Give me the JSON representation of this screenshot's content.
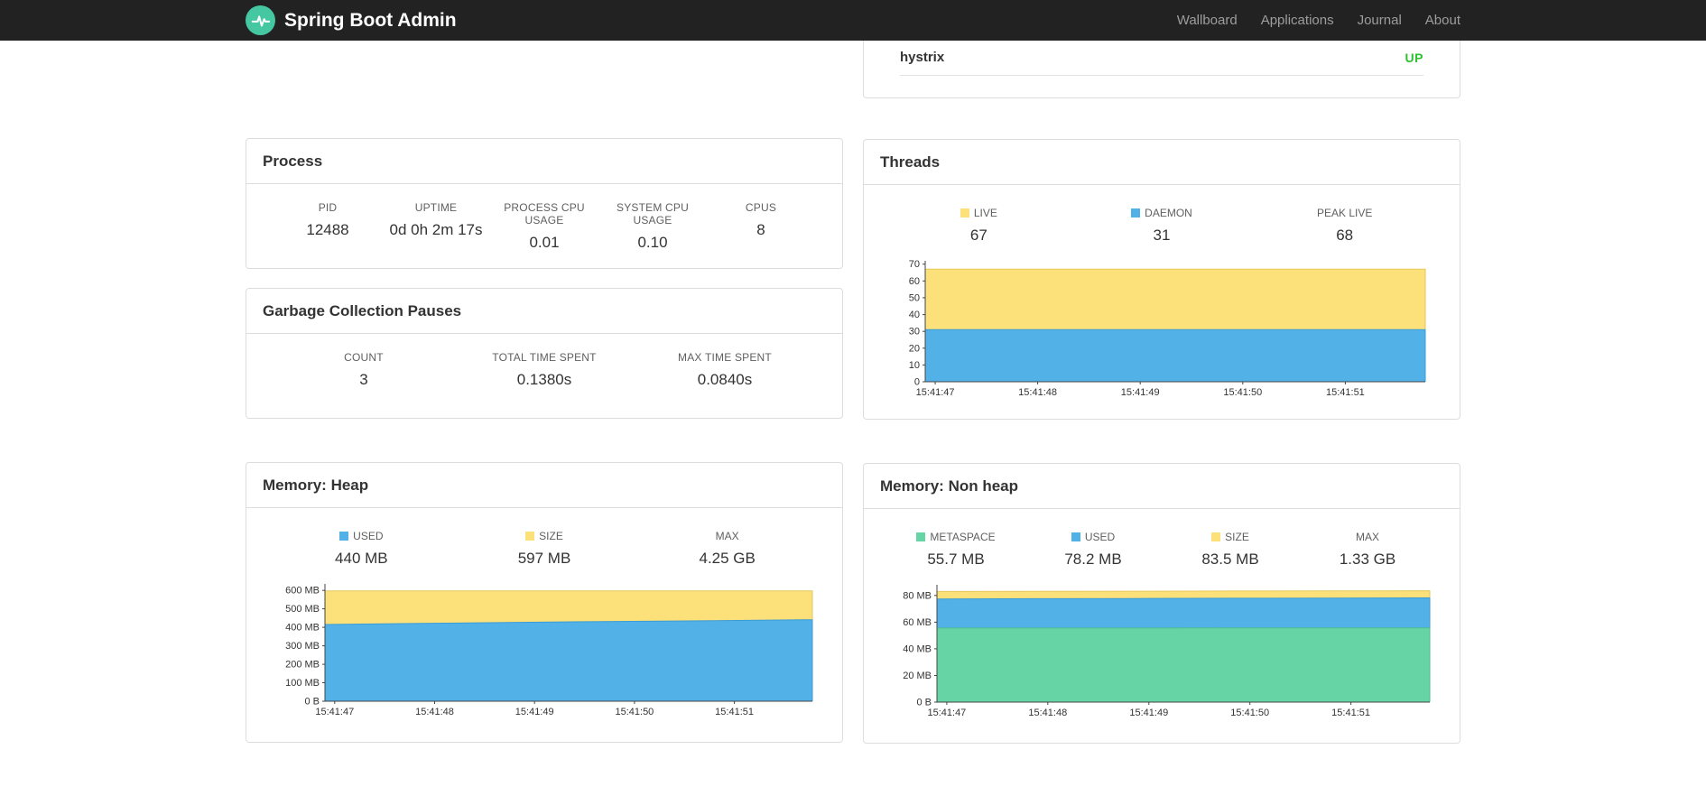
{
  "colors": {
    "brand_teal": "#45C8A2",
    "navbar_bg": "#222222"
  },
  "navbar": {
    "brand": "Spring Boot Admin",
    "links": [
      {
        "label": "Wallboard"
      },
      {
        "label": "Applications"
      },
      {
        "label": "Journal"
      },
      {
        "label": "About"
      }
    ]
  },
  "applications_panel": {
    "app_name": "hystrix",
    "status": "UP",
    "status_color": "#2EC12E"
  },
  "process": {
    "title": "Process",
    "metrics": [
      {
        "label": "PID",
        "value": "12488"
      },
      {
        "label": "UPTIME",
        "value": "0d 0h 2m 17s"
      },
      {
        "label": "PROCESS CPU USAGE",
        "value": "0.01"
      },
      {
        "label": "SYSTEM CPU USAGE",
        "value": "0.10"
      },
      {
        "label": "CPUS",
        "value": "8"
      }
    ]
  },
  "gc": {
    "title": "Garbage Collection Pauses",
    "metrics": [
      {
        "label": "COUNT",
        "value": "3"
      },
      {
        "label": "TOTAL TIME SPENT",
        "value": "0.1380s"
      },
      {
        "label": "MAX TIME SPENT",
        "value": "0.0840s"
      }
    ]
  },
  "threads": {
    "title": "Threads",
    "legend": [
      {
        "label": "LIVE",
        "value": "67",
        "color": "#FCE17B"
      },
      {
        "label": "DAEMON",
        "value": "31",
        "color": "#52B2E8"
      },
      {
        "label": "PEAK LIVE",
        "value": "68"
      }
    ]
  },
  "memory_heap": {
    "title": "Memory: Heap",
    "legend": [
      {
        "label": "USED",
        "value": "440 MB",
        "color": "#52B2E8"
      },
      {
        "label": "SIZE",
        "value": "597 MB",
        "color": "#FCE17B"
      },
      {
        "label": "MAX",
        "value": "4.25 GB"
      }
    ]
  },
  "memory_nonheap": {
    "title": "Memory: Non heap",
    "legend": [
      {
        "label": "METASPACE",
        "value": "55.7 MB",
        "color": "#67D4A6"
      },
      {
        "label": "USED",
        "value": "78.2 MB",
        "color": "#52B2E8"
      },
      {
        "label": "SIZE",
        "value": "83.5 MB",
        "color": "#FCE17B"
      },
      {
        "label": "MAX",
        "value": "1.33 GB"
      }
    ]
  },
  "chart_data": [
    {
      "id": "threads-chart",
      "type": "area",
      "title": "Threads",
      "xlabel": "",
      "ylabel": "",
      "legend_position": "top",
      "grid": false,
      "x_ticks": [
        "15:41:47",
        "15:41:48",
        "15:41:49",
        "15:41:50",
        "15:41:51"
      ],
      "y_ticks": [
        {
          "label": "0",
          "value": 0
        },
        {
          "label": "10",
          "value": 10
        },
        {
          "label": "20",
          "value": 20
        },
        {
          "label": "30",
          "value": 30
        },
        {
          "label": "40",
          "value": 40
        },
        {
          "label": "50",
          "value": 50
        },
        {
          "label": "60",
          "value": 60
        },
        {
          "label": "70",
          "value": 70
        }
      ],
      "ylim": [
        0,
        72
      ],
      "series": [
        {
          "name": "LIVE",
          "color": "#FCE17B",
          "stroke": "#E5C75B",
          "values": [
            67,
            67,
            67,
            67,
            67,
            67
          ]
        },
        {
          "name": "DAEMON",
          "color": "#52B2E8",
          "stroke": "#3B9BD6",
          "values": [
            31,
            31,
            31,
            31,
            31,
            31
          ]
        }
      ]
    },
    {
      "id": "memory-heap-chart",
      "type": "area",
      "title": "Memory: Heap",
      "xlabel": "",
      "ylabel": "",
      "legend_position": "top",
      "grid": false,
      "x_ticks": [
        "15:41:47",
        "15:41:48",
        "15:41:49",
        "15:41:50",
        "15:41:51"
      ],
      "y_ticks": [
        {
          "label": "0 B",
          "value": 0
        },
        {
          "label": "100 MB",
          "value": 100
        },
        {
          "label": "200 MB",
          "value": 200
        },
        {
          "label": "300 MB",
          "value": 300
        },
        {
          "label": "400 MB",
          "value": 400
        },
        {
          "label": "500 MB",
          "value": 500
        },
        {
          "label": "600 MB",
          "value": 600
        }
      ],
      "ylim": [
        0,
        635
      ],
      "series": [
        {
          "name": "SIZE",
          "color": "#FCE17B",
          "stroke": "#E5C75B",
          "values": [
            597,
            597,
            597,
            597,
            597,
            597
          ]
        },
        {
          "name": "USED",
          "color": "#52B2E8",
          "stroke": "#3B9BD6",
          "values": [
            415,
            421,
            427,
            432,
            436,
            441
          ]
        }
      ]
    },
    {
      "id": "memory-nonheap-chart",
      "type": "area",
      "title": "Memory: Non heap",
      "xlabel": "",
      "ylabel": "",
      "legend_position": "top",
      "grid": false,
      "x_ticks": [
        "15:41:47",
        "15:41:48",
        "15:41:49",
        "15:41:50",
        "15:41:51"
      ],
      "y_ticks": [
        {
          "label": "0 B",
          "value": 0
        },
        {
          "label": "20 MB",
          "value": 20
        },
        {
          "label": "40 MB",
          "value": 40
        },
        {
          "label": "60 MB",
          "value": 60
        },
        {
          "label": "80 MB",
          "value": 80
        }
      ],
      "ylim": [
        0,
        88
      ],
      "series": [
        {
          "name": "SIZE",
          "color": "#FCE17B",
          "stroke": "#E5C75B",
          "values": [
            83.0,
            83.1,
            83.2,
            83.3,
            83.4,
            83.5
          ]
        },
        {
          "name": "USED",
          "color": "#52B2E8",
          "stroke": "#3B9BD6",
          "values": [
            77.4,
            77.6,
            77.7,
            77.9,
            78.0,
            78.2
          ]
        },
        {
          "name": "METASPACE",
          "color": "#67D4A6",
          "stroke": "#4FBE8E",
          "values": [
            55.6,
            55.6,
            55.6,
            55.7,
            55.7,
            55.7
          ]
        }
      ]
    }
  ]
}
